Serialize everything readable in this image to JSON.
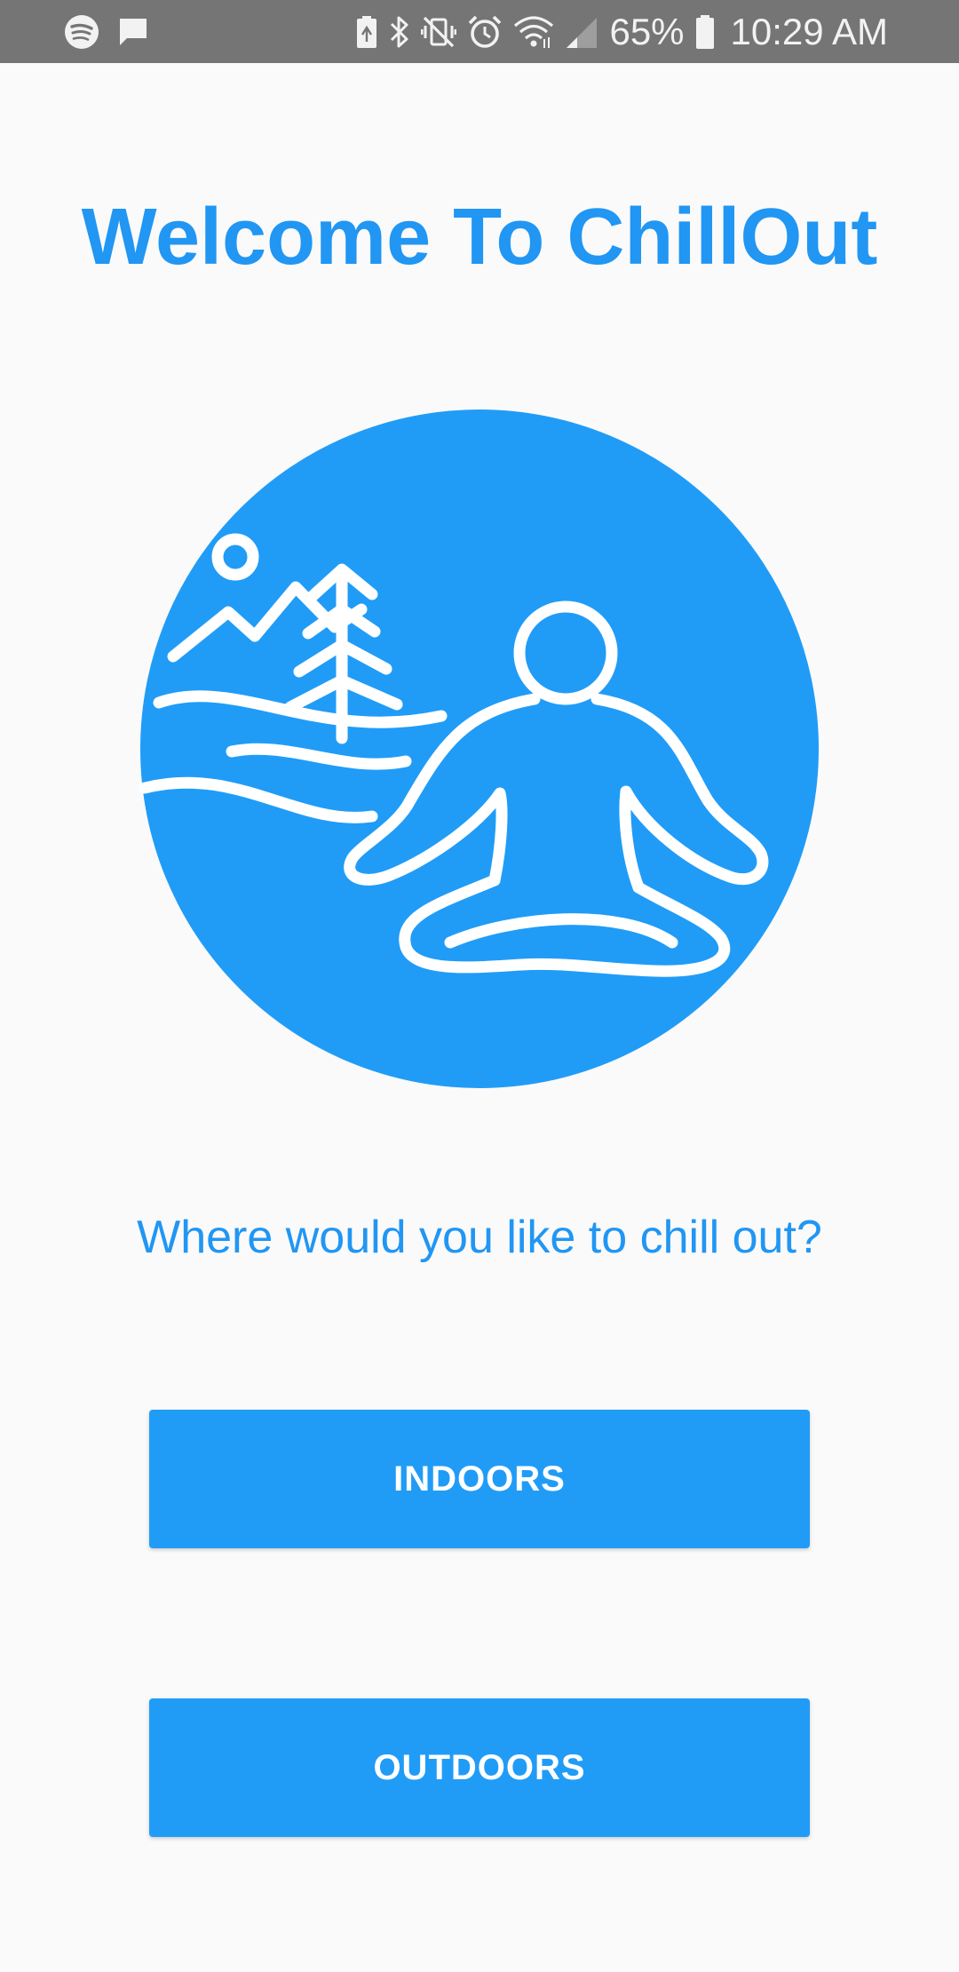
{
  "status_bar": {
    "battery_percent": "65%",
    "time": "10:29 AM",
    "left_icons": [
      "spotify-icon",
      "message-icon"
    ],
    "right_icons": [
      "battery-saver-icon",
      "bluetooth-icon",
      "vibrate-icon",
      "alarm-icon",
      "wifi-icon",
      "signal-icon",
      "battery-icon"
    ]
  },
  "main": {
    "title": "Welcome To ChillOut",
    "logo_icon": "meditation-nature-logo",
    "question": "Where would you like to chill out?",
    "buttons": {
      "indoors": "INDOORS",
      "outdoors": "OUTDOORS"
    }
  },
  "colors": {
    "accent": "#2196f3",
    "button": "#209cf7",
    "status_bar": "#757575",
    "background": "#fafafa"
  }
}
